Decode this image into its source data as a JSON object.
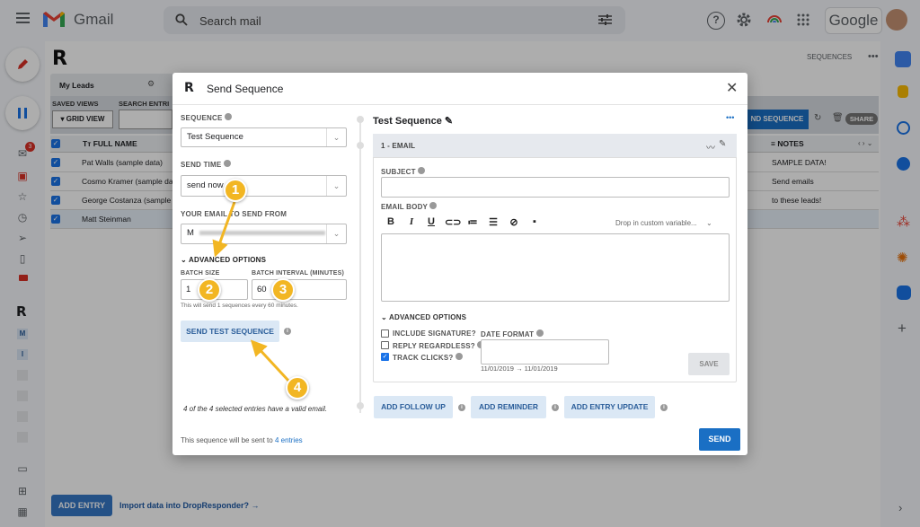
{
  "gmail": {
    "app_name": "Gmail",
    "search_placeholder": "Search mail",
    "brand": "Google",
    "inbox_badge": "3"
  },
  "background_app": {
    "logo": "R",
    "sequences_link": "SEQUENCES",
    "tab_label": "My Leads",
    "saved_views_label": "SAVED VIEWS",
    "search_entries_label": "SEARCH ENTRI",
    "grid_view_label": "GRID VIEW",
    "send_sequence_label": "ND SEQUENCE",
    "share_label": "SHARE",
    "columns": {
      "full_name": "FULL NAME",
      "notes": "NOTES"
    },
    "rows": [
      {
        "name": "Pat Walls (sample data)",
        "notes": "SAMPLE DATA!"
      },
      {
        "name": "Cosmo Kramer (sample da",
        "notes": "Send emails"
      },
      {
        "name": "George Costanza (sample",
        "notes": "to these leads!"
      },
      {
        "name": "Matt Steinman",
        "notes": ""
      }
    ],
    "add_entry_label": "ADD ENTRY",
    "import_label": "Import data into DropResponder? →",
    "sidebar_letters": [
      "M",
      "I"
    ]
  },
  "modal": {
    "title": "Send Sequence",
    "left": {
      "sequence_label": "SEQUENCE",
      "sequence_value": "Test Sequence",
      "send_time_label": "SEND TIME",
      "send_time_value": "send now",
      "from_label": "YOUR EMAIL TO SEND FROM",
      "from_value": "M",
      "advanced_options_label": "ADVANCED OPTIONS",
      "batch_size_label": "BATCH SIZE",
      "batch_size_value": "1",
      "batch_interval_label": "BATCH INTERVAL (MINUTES)",
      "batch_interval_value": "60",
      "batch_hint": "This will send 1 sequences every 60 minutes.",
      "send_test_label": "SEND TEST SEQUENCE",
      "valid_note": "4 of the 4 selected entries have a valid email.",
      "footer_text": "This sequence will be sent to",
      "footer_link": "4 entries"
    },
    "right": {
      "sequence_title": "Test Sequence",
      "step_label": "1 - EMAIL",
      "subject_label": "SUBJECT",
      "email_body_label": "EMAIL BODY",
      "custom_variable_placeholder": "Drop in custom variable...",
      "advanced_options_label": "ADVANCED OPTIONS",
      "include_signature_label": "INCLUDE SIGNATURE?",
      "reply_regardless_label": "REPLY REGARDLESS?",
      "track_clicks_label": "TRACK CLICKS?",
      "include_signature_checked": false,
      "reply_regardless_checked": false,
      "track_clicks_checked": true,
      "date_format_label": "DATE FORMAT",
      "date_preview": "11/01/2019 → 11/01/2019",
      "save_label": "SAVE",
      "add_follow_up_label": "ADD FOLLOW UP",
      "add_reminder_label": "ADD REMINDER",
      "add_entry_update_label": "ADD ENTRY UPDATE",
      "send_label": "SEND"
    }
  },
  "callouts": [
    "1",
    "2",
    "3",
    "4"
  ],
  "colors": {
    "accent": "#1a6fc4",
    "callout": "#f2b623",
    "gmail_red": "#ea4335"
  }
}
